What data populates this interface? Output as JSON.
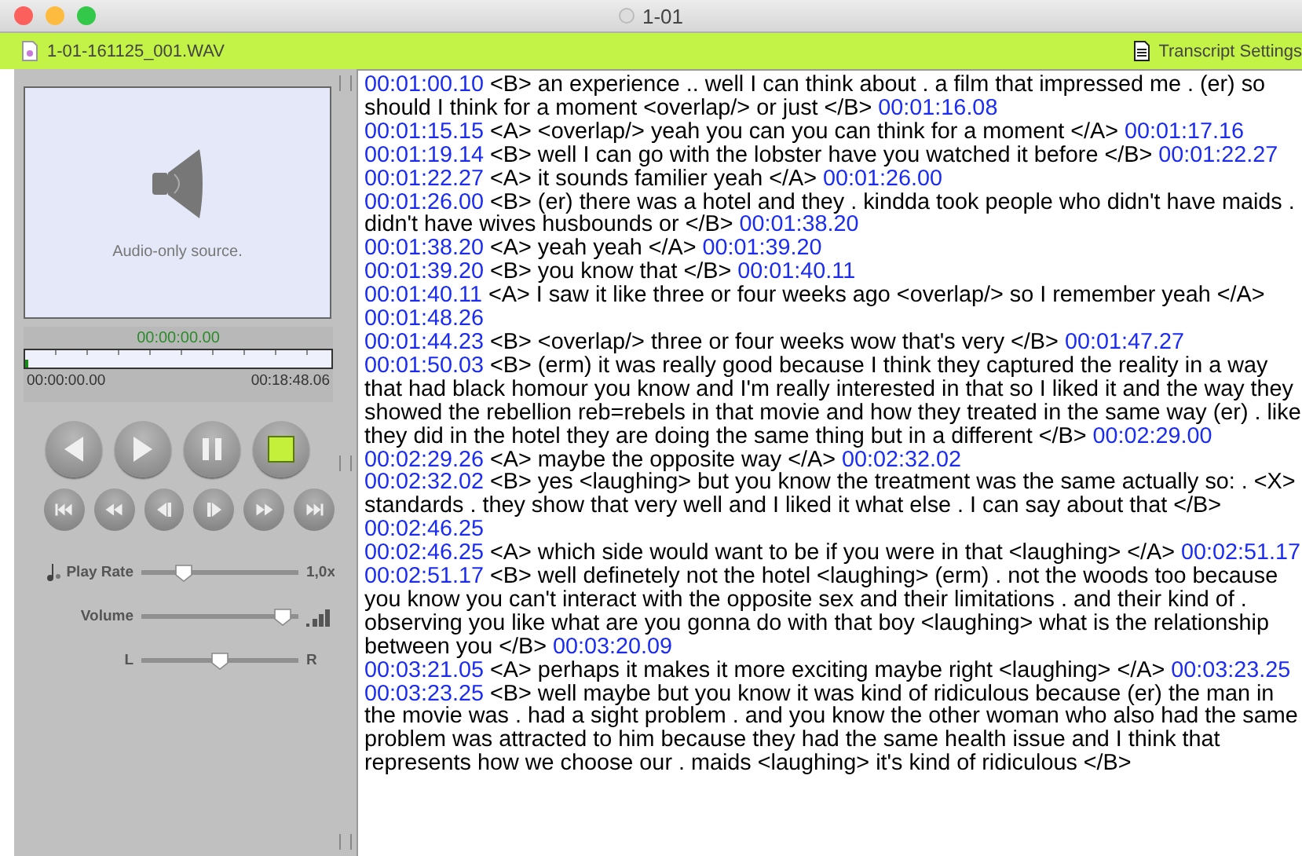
{
  "window": {
    "title": "1-01"
  },
  "toolbar": {
    "file_name": "1-01-161125_001.WAV",
    "settings_label": "Transcript Settings"
  },
  "player": {
    "source_label": "Audio-only source.",
    "current_time": "00:00:00.00",
    "start_time": "00:00:00.00",
    "end_time": "00:18:48.06",
    "position": {
      "level": 0.0
    },
    "main_buttons": [
      {
        "kind": "back"
      },
      {
        "kind": "play"
      },
      {
        "kind": "pause"
      },
      {
        "kind": "stop"
      }
    ],
    "step_buttons": [
      {
        "kind": "first"
      },
      {
        "kind": "rewind"
      },
      {
        "kind": "step-back"
      },
      {
        "kind": "step-forward"
      },
      {
        "kind": "fast-forward"
      },
      {
        "kind": "last"
      }
    ],
    "sliders": [
      {
        "kind": "rate",
        "label": "Play Rate",
        "level": 0.24,
        "reading": "1,0x"
      },
      {
        "kind": "volume",
        "label": "Volume",
        "level": 0.95
      },
      {
        "kind": "balance",
        "label": "L",
        "level": 0.5,
        "right_label": "R"
      }
    ]
  },
  "transcript": [
    {
      "start": "00:01:00.10",
      "text": "<B> an experience .. well I can think about . a film that impressed me . (er) so should I think for a moment  <overlap/> or just </B>",
      "end": "00:01:16.08"
    },
    {
      "start": "00:01:15.15",
      "text": "<A> <overlap/> yeah you can you can think for a moment </A>",
      "end": "00:01:17.16"
    },
    {
      "start": "00:01:19.14",
      "text": "<B> well I can go with the lobster have you watched it before </B>",
      "end": "00:01:22.27"
    },
    {
      "start": "00:01:22.27",
      "text": "<A> it sounds familier yeah </A>",
      "end": "00:01:26.00"
    },
    {
      "start": "00:01:26.00",
      "text": "<B> (er) there was a hotel and they . kindda took people who didn't have maids . didn't have wives husbounds or </B>",
      "end": "00:01:38.20"
    },
    {
      "start": "00:01:38.20",
      "text": "<A> yeah yeah </A>",
      "end": "00:01:39.20"
    },
    {
      "start": "00:01:39.20",
      "text": "<B> you know that </B>",
      "end": "00:01:40.11"
    },
    {
      "start": "00:01:40.11",
      "text": "<A> I saw it like three or four weeks ago <overlap/> so I remember yeah </A>",
      "end": "00:01:48.26"
    },
    {
      "start": "00:01:44.23",
      "text": "<B> <overlap/> three or four weeks wow that's very </B>",
      "end": "00:01:47.27"
    },
    {
      "start": "00:01:50.03",
      "text": "<B> (erm) it was really good because I think they captured the reality in a way that had black homour you know and I'm really interested in that so I liked it and the way they showed the rebellion reb=rebels in that movie and how they treated in the same way (er) . like they did in the hotel they are doing the same thing but in a different </B>",
      "end": "00:02:29.00"
    },
    {
      "start": "00:02:29.26",
      "text": "<A> maybe the opposite way </A>",
      "end": "00:02:32.02"
    },
    {
      "start": "00:02:32.02",
      "text": "<B> yes <laughing> but you know the treatment was the same actually so: . <X> standards . they show that very well and I liked it what else . I can say about that </B>",
      "end": "00:02:46.25"
    },
    {
      "start": "00:02:46.25",
      "text": "<A> which side would want to be if you were in that <laughing> </A>",
      "end": "00:02:51.17"
    },
    {
      "start": "00:02:51.17",
      "text": "<B> well definetely not the hotel <laughing> (erm) . not the woods too because you know you can't interact with the opposite sex and their limitations . and their kind of . observing you like what are you gonna do with that boy <laughing> what is the relationship between you </B>",
      "end": "00:03:20.09"
    },
    {
      "start": "00:03:21.05",
      "text": "<A> perhaps it makes it more exciting maybe right <laughing> </A>",
      "end": "00:03:23.25"
    },
    {
      "start": "00:03:23.25",
      "text": "<B> well maybe but you know it was kind of ridiculous because (er) the man in the movie was . had a sight problem . and you know the other woman who also had the same problem was attracted to him because they had the same health issue and I think that represents how we choose our . maids <laughing> it's kind of ridiculous </B>"
    }
  ]
}
